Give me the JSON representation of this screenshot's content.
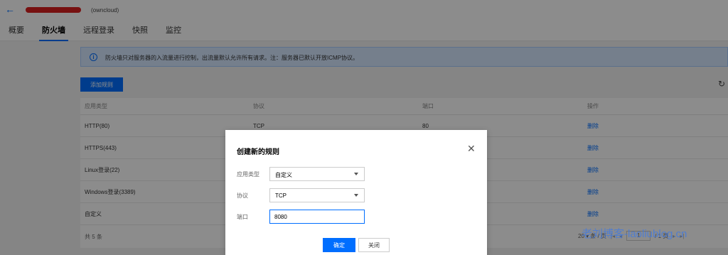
{
  "header": {
    "back_icon": "arrow-left-icon",
    "server_name": "",
    "server_sub": "(owncloud)"
  },
  "tabs": [
    {
      "label": "概要"
    },
    {
      "label": "防火墙",
      "active": true
    },
    {
      "label": "远程登录"
    },
    {
      "label": "快照"
    },
    {
      "label": "监控"
    }
  ],
  "notice": {
    "icon": "info-icon",
    "text": "防火墙只对服务器的入流量进行控制，出流量默认允许所有请求。注：服务器已默认开放ICMP协议。"
  },
  "toolbar": {
    "add_rule_label": "添加规则",
    "refresh_icon": "refresh-icon"
  },
  "table": {
    "headers": [
      "应用类型",
      "协议",
      "端口",
      "操作"
    ],
    "rows": [
      {
        "type": "HTTP(80)",
        "protocol": "TCP",
        "port": "80",
        "action": "删除"
      },
      {
        "type": "HTTPS(443)",
        "protocol": "",
        "port": "",
        "action": "删除"
      },
      {
        "type": "Linux登录(22)",
        "protocol": "",
        "port": "",
        "action": "删除"
      },
      {
        "type": "Windows登录(3389)",
        "protocol": "",
        "port": "",
        "action": "删除"
      },
      {
        "type": "自定义",
        "protocol": "",
        "port": "",
        "action": "删除"
      }
    ],
    "total": "共 5 条",
    "page_size": "20 ▾ 条 / 页",
    "first_label": "|◂",
    "prev_label": "◂",
    "page_input": "1",
    "page_total": "/ 1 页",
    "next_label": "▸",
    "last_label": "▸|"
  },
  "modal": {
    "title": "创建新的规则",
    "fields": {
      "app_type_label": "应用类型",
      "app_type_value": "自定义",
      "protocol_label": "协议",
      "protocol_value": "TCP",
      "port_label": "端口",
      "port_value": "8080"
    },
    "confirm_label": "确定",
    "close_label": "关闭"
  },
  "watermark": "老刘博客-laoliublog.cn",
  "colors": {
    "accent": "#006eff",
    "notice_bg": "#d5e7ff",
    "redaction": "#d9201f"
  }
}
